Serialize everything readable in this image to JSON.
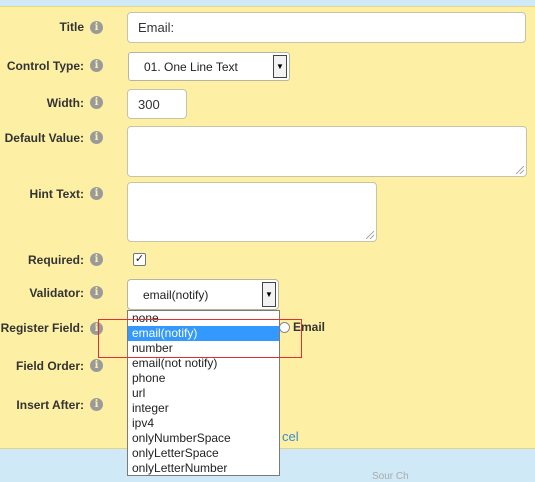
{
  "form": {
    "title_label": "Title",
    "title_value": "Email:",
    "control_type_label": "Control Type:",
    "control_type_value": "01. One Line Text",
    "width_label": "Width:",
    "width_value": "300",
    "default_value_label": "Default Value:",
    "hint_text_label": "Hint Text:",
    "required_label": "Required:",
    "required_checked": true,
    "validator_label": "Validator:",
    "validator_value": "email(notify)",
    "register_field_label": "Register Field:",
    "register_field_option": "Email",
    "field_order_label": "Field Order:",
    "insert_after_label": "Insert After:",
    "cancel_label": "cel"
  },
  "validator_options": [
    "none",
    "email(notify)",
    "number",
    "email(not notify)",
    "phone",
    "url",
    "integer",
    "ipv4",
    "onlyNumberSpace",
    "onlyLetterSpace",
    "onlyLetterNumber"
  ],
  "validator_selected_index": 1,
  "footer": {
    "partial_text": "Sour Ch"
  },
  "icons": {
    "info": "info-icon",
    "dropdown_arrow": "chevron-down-icon",
    "check": "checkmark-icon",
    "resize": "resize-grip-icon"
  },
  "colors": {
    "panel_bg": "#fdf0a5",
    "page_bg": "#cfe9f6",
    "highlight": "#3399ff",
    "annotation_box": "#e03030",
    "link": "#3a8ad2"
  }
}
